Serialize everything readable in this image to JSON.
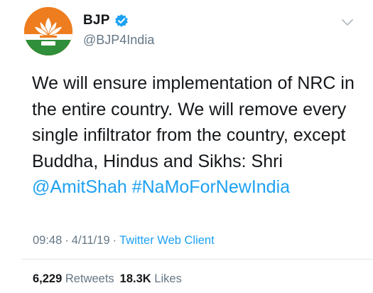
{
  "author": {
    "display_name": "BJP",
    "handle": "@BJP4India",
    "verified": true,
    "avatar": "bjp-lotus-logo"
  },
  "menu_icon": "chevron-down-icon",
  "tweet": {
    "text_lines": [
      "We will ensure implementation of NRC in",
      "the entire country. We will remove every",
      "single infiltrator from the country, except",
      "Buddha, Hindus and Sikhs: Shri"
    ],
    "mention": "@AmitShah",
    "hashtag": "#NaMoForNewIndia"
  },
  "meta": {
    "time": "09:48",
    "separator": "·",
    "date": "4/11/19",
    "source": "Twitter Web Client"
  },
  "stats": {
    "retweets_count": "6,229",
    "retweets_label": "Retweets",
    "likes_count": "18.3K",
    "likes_label": "Likes"
  },
  "colors": {
    "link": "#1da1f2",
    "muted": "#657786",
    "text": "#14171a",
    "avatar_bg": "#ee7d1f"
  }
}
